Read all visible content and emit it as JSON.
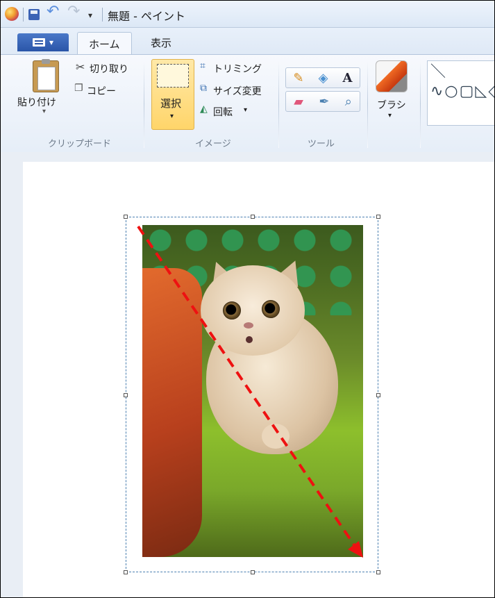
{
  "window": {
    "title": "無題 - ペイント"
  },
  "tabs": [
    {
      "label": "ホーム",
      "active": true
    },
    {
      "label": "表示",
      "active": false
    }
  ],
  "ribbon": {
    "clipboard": {
      "paste": "貼り付け",
      "cut": "切り取り",
      "copy": "コピー",
      "group_label": "クリップボード"
    },
    "image": {
      "select": "選択",
      "crop": "トリミング",
      "resize": "サイズ変更",
      "rotate": "回転",
      "group_label": "イメージ"
    },
    "tools": {
      "group_label": "ツール"
    },
    "brush": {
      "label": "ブラシ"
    },
    "shapes": {
      "symbols": "＼∿○▢◺◇⬠⬡⇩✧☆✶"
    }
  },
  "canvas": {
    "background": "#ffffff",
    "selection_color": "#4a7fb0",
    "arrow_color": "#ee1111",
    "photo_subject": "cat-photo"
  }
}
